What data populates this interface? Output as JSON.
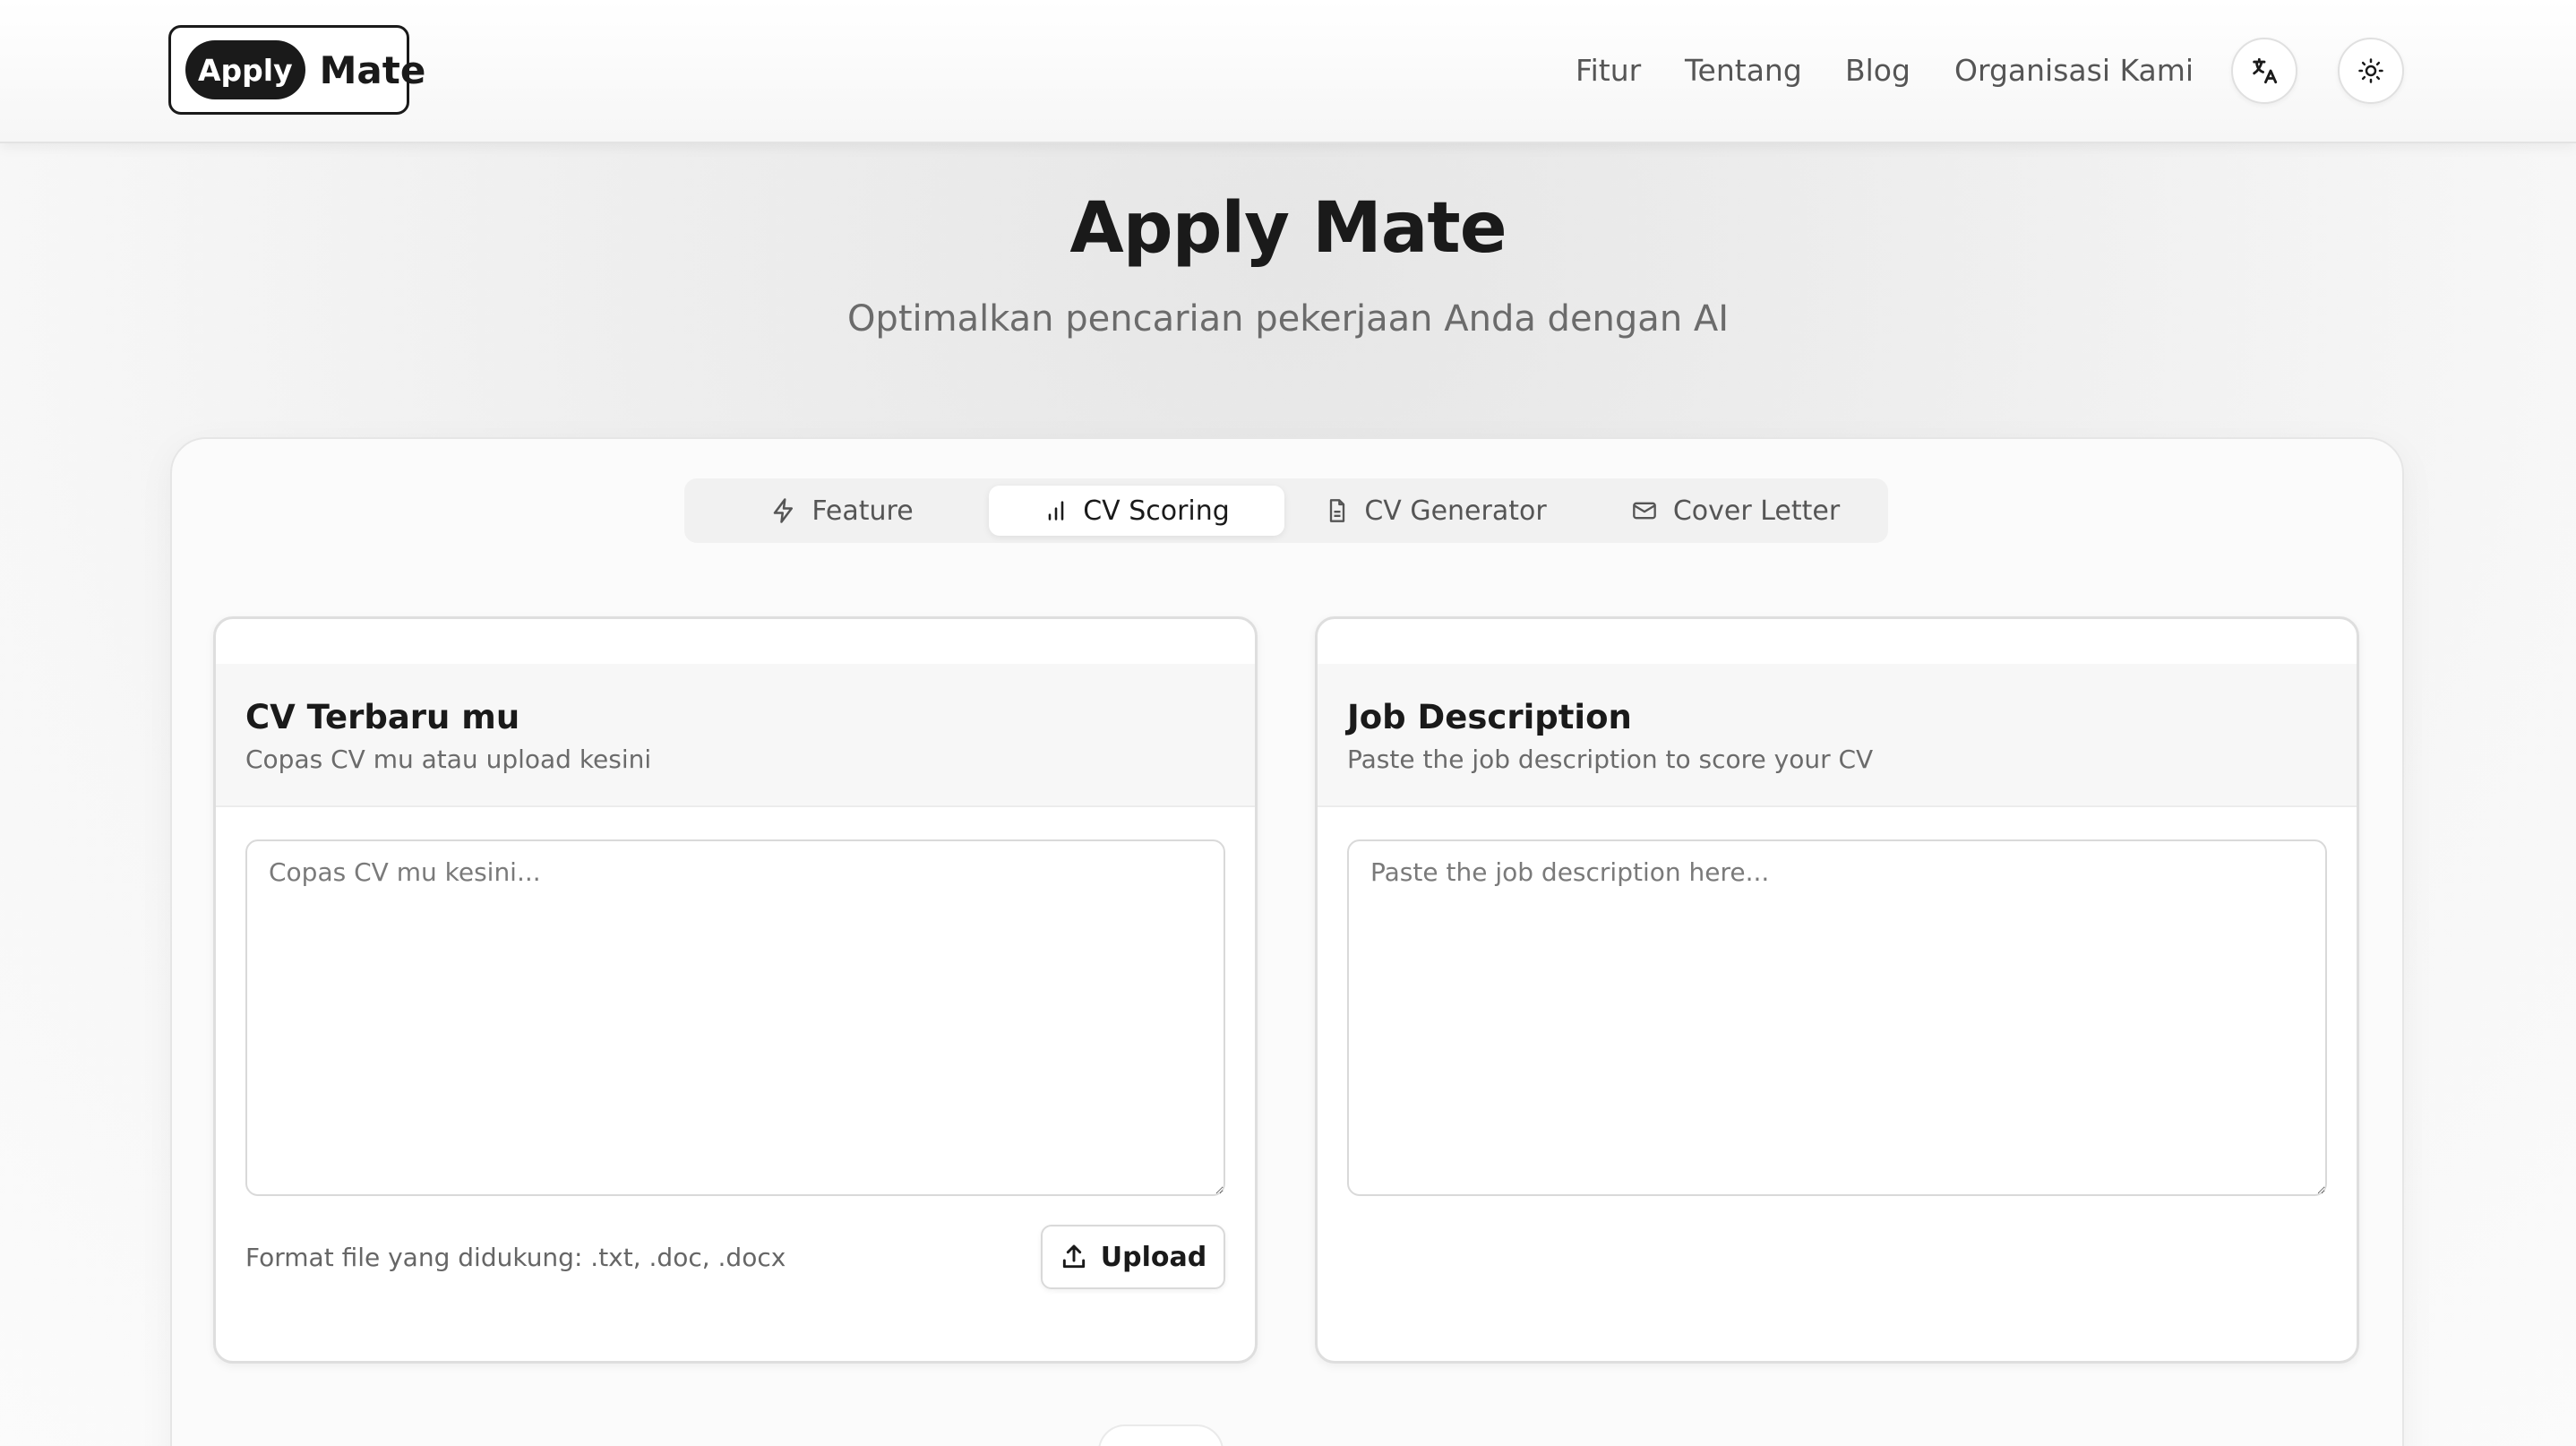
{
  "header": {
    "logo_pill": "Apply",
    "logo_text": "Mate",
    "nav": [
      "Fitur",
      "Tentang",
      "Blog",
      "Organisasi Kami"
    ],
    "language_icon": "translate-icon",
    "theme_icon": "sun-icon"
  },
  "hero": {
    "title": "Apply Mate",
    "subtitle": "Optimalkan pencarian pekerjaan Anda dengan AI"
  },
  "tabs": [
    {
      "label": "Feature",
      "icon": "bolt-icon",
      "active": false
    },
    {
      "label": "CV Scoring",
      "icon": "bar-chart-icon",
      "active": true
    },
    {
      "label": "CV Generator",
      "icon": "document-icon",
      "active": false
    },
    {
      "label": "Cover Letter",
      "icon": "mail-icon",
      "active": false
    }
  ],
  "cv_panel": {
    "title": "CV Terbaru mu",
    "description": "Copas CV mu atau upload kesini",
    "placeholder": "Copas CV mu kesini...",
    "file_note": "Format file yang didukung: .txt, .doc, .docx",
    "upload_label": "Upload"
  },
  "job_panel": {
    "title": "Job Description",
    "description": "Paste the job description to score your CV",
    "placeholder": "Paste the job description here..."
  }
}
